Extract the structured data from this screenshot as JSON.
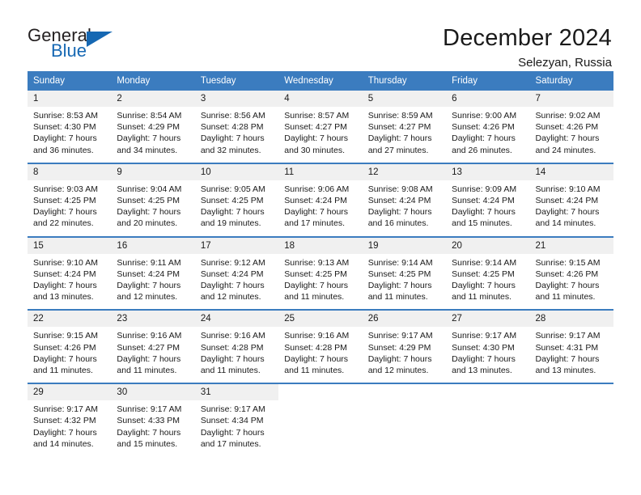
{
  "logo": {
    "word_top": "General",
    "word_bottom": "Blue",
    "triangle_color": "#1668b3"
  },
  "header": {
    "title": "December 2024",
    "subtitle": "Selezyan, Russia"
  },
  "theme": {
    "header_blue": "#3b7cbf",
    "daynum_bg": "#f0f0f0",
    "text": "#1a1a1a"
  },
  "calendar": {
    "weekday_headers": [
      "Sunday",
      "Monday",
      "Tuesday",
      "Wednesday",
      "Thursday",
      "Friday",
      "Saturday"
    ],
    "weeks": [
      [
        {
          "day": "1",
          "sunrise": "Sunrise: 8:53 AM",
          "sunset": "Sunset: 4:30 PM",
          "daylight_line1": "Daylight: 7 hours",
          "daylight_line2": "and 36 minutes."
        },
        {
          "day": "2",
          "sunrise": "Sunrise: 8:54 AM",
          "sunset": "Sunset: 4:29 PM",
          "daylight_line1": "Daylight: 7 hours",
          "daylight_line2": "and 34 minutes."
        },
        {
          "day": "3",
          "sunrise": "Sunrise: 8:56 AM",
          "sunset": "Sunset: 4:28 PM",
          "daylight_line1": "Daylight: 7 hours",
          "daylight_line2": "and 32 minutes."
        },
        {
          "day": "4",
          "sunrise": "Sunrise: 8:57 AM",
          "sunset": "Sunset: 4:27 PM",
          "daylight_line1": "Daylight: 7 hours",
          "daylight_line2": "and 30 minutes."
        },
        {
          "day": "5",
          "sunrise": "Sunrise: 8:59 AM",
          "sunset": "Sunset: 4:27 PM",
          "daylight_line1": "Daylight: 7 hours",
          "daylight_line2": "and 27 minutes."
        },
        {
          "day": "6",
          "sunrise": "Sunrise: 9:00 AM",
          "sunset": "Sunset: 4:26 PM",
          "daylight_line1": "Daylight: 7 hours",
          "daylight_line2": "and 26 minutes."
        },
        {
          "day": "7",
          "sunrise": "Sunrise: 9:02 AM",
          "sunset": "Sunset: 4:26 PM",
          "daylight_line1": "Daylight: 7 hours",
          "daylight_line2": "and 24 minutes."
        }
      ],
      [
        {
          "day": "8",
          "sunrise": "Sunrise: 9:03 AM",
          "sunset": "Sunset: 4:25 PM",
          "daylight_line1": "Daylight: 7 hours",
          "daylight_line2": "and 22 minutes."
        },
        {
          "day": "9",
          "sunrise": "Sunrise: 9:04 AM",
          "sunset": "Sunset: 4:25 PM",
          "daylight_line1": "Daylight: 7 hours",
          "daylight_line2": "and 20 minutes."
        },
        {
          "day": "10",
          "sunrise": "Sunrise: 9:05 AM",
          "sunset": "Sunset: 4:25 PM",
          "daylight_line1": "Daylight: 7 hours",
          "daylight_line2": "and 19 minutes."
        },
        {
          "day": "11",
          "sunrise": "Sunrise: 9:06 AM",
          "sunset": "Sunset: 4:24 PM",
          "daylight_line1": "Daylight: 7 hours",
          "daylight_line2": "and 17 minutes."
        },
        {
          "day": "12",
          "sunrise": "Sunrise: 9:08 AM",
          "sunset": "Sunset: 4:24 PM",
          "daylight_line1": "Daylight: 7 hours",
          "daylight_line2": "and 16 minutes."
        },
        {
          "day": "13",
          "sunrise": "Sunrise: 9:09 AM",
          "sunset": "Sunset: 4:24 PM",
          "daylight_line1": "Daylight: 7 hours",
          "daylight_line2": "and 15 minutes."
        },
        {
          "day": "14",
          "sunrise": "Sunrise: 9:10 AM",
          "sunset": "Sunset: 4:24 PM",
          "daylight_line1": "Daylight: 7 hours",
          "daylight_line2": "and 14 minutes."
        }
      ],
      [
        {
          "day": "15",
          "sunrise": "Sunrise: 9:10 AM",
          "sunset": "Sunset: 4:24 PM",
          "daylight_line1": "Daylight: 7 hours",
          "daylight_line2": "and 13 minutes."
        },
        {
          "day": "16",
          "sunrise": "Sunrise: 9:11 AM",
          "sunset": "Sunset: 4:24 PM",
          "daylight_line1": "Daylight: 7 hours",
          "daylight_line2": "and 12 minutes."
        },
        {
          "day": "17",
          "sunrise": "Sunrise: 9:12 AM",
          "sunset": "Sunset: 4:24 PM",
          "daylight_line1": "Daylight: 7 hours",
          "daylight_line2": "and 12 minutes."
        },
        {
          "day": "18",
          "sunrise": "Sunrise: 9:13 AM",
          "sunset": "Sunset: 4:25 PM",
          "daylight_line1": "Daylight: 7 hours",
          "daylight_line2": "and 11 minutes."
        },
        {
          "day": "19",
          "sunrise": "Sunrise: 9:14 AM",
          "sunset": "Sunset: 4:25 PM",
          "daylight_line1": "Daylight: 7 hours",
          "daylight_line2": "and 11 minutes."
        },
        {
          "day": "20",
          "sunrise": "Sunrise: 9:14 AM",
          "sunset": "Sunset: 4:25 PM",
          "daylight_line1": "Daylight: 7 hours",
          "daylight_line2": "and 11 minutes."
        },
        {
          "day": "21",
          "sunrise": "Sunrise: 9:15 AM",
          "sunset": "Sunset: 4:26 PM",
          "daylight_line1": "Daylight: 7 hours",
          "daylight_line2": "and 11 minutes."
        }
      ],
      [
        {
          "day": "22",
          "sunrise": "Sunrise: 9:15 AM",
          "sunset": "Sunset: 4:26 PM",
          "daylight_line1": "Daylight: 7 hours",
          "daylight_line2": "and 11 minutes."
        },
        {
          "day": "23",
          "sunrise": "Sunrise: 9:16 AM",
          "sunset": "Sunset: 4:27 PM",
          "daylight_line1": "Daylight: 7 hours",
          "daylight_line2": "and 11 minutes."
        },
        {
          "day": "24",
          "sunrise": "Sunrise: 9:16 AM",
          "sunset": "Sunset: 4:28 PM",
          "daylight_line1": "Daylight: 7 hours",
          "daylight_line2": "and 11 minutes."
        },
        {
          "day": "25",
          "sunrise": "Sunrise: 9:16 AM",
          "sunset": "Sunset: 4:28 PM",
          "daylight_line1": "Daylight: 7 hours",
          "daylight_line2": "and 11 minutes."
        },
        {
          "day": "26",
          "sunrise": "Sunrise: 9:17 AM",
          "sunset": "Sunset: 4:29 PM",
          "daylight_line1": "Daylight: 7 hours",
          "daylight_line2": "and 12 minutes."
        },
        {
          "day": "27",
          "sunrise": "Sunrise: 9:17 AM",
          "sunset": "Sunset: 4:30 PM",
          "daylight_line1": "Daylight: 7 hours",
          "daylight_line2": "and 13 minutes."
        },
        {
          "day": "28",
          "sunrise": "Sunrise: 9:17 AM",
          "sunset": "Sunset: 4:31 PM",
          "daylight_line1": "Daylight: 7 hours",
          "daylight_line2": "and 13 minutes."
        }
      ],
      [
        {
          "day": "29",
          "sunrise": "Sunrise: 9:17 AM",
          "sunset": "Sunset: 4:32 PM",
          "daylight_line1": "Daylight: 7 hours",
          "daylight_line2": "and 14 minutes."
        },
        {
          "day": "30",
          "sunrise": "Sunrise: 9:17 AM",
          "sunset": "Sunset: 4:33 PM",
          "daylight_line1": "Daylight: 7 hours",
          "daylight_line2": "and 15 minutes."
        },
        {
          "day": "31",
          "sunrise": "Sunrise: 9:17 AM",
          "sunset": "Sunset: 4:34 PM",
          "daylight_line1": "Daylight: 7 hours",
          "daylight_line2": "and 17 minutes."
        },
        {
          "day": "",
          "sunrise": "",
          "sunset": "",
          "daylight_line1": "",
          "daylight_line2": ""
        },
        {
          "day": "",
          "sunrise": "",
          "sunset": "",
          "daylight_line1": "",
          "daylight_line2": ""
        },
        {
          "day": "",
          "sunrise": "",
          "sunset": "",
          "daylight_line1": "",
          "daylight_line2": ""
        },
        {
          "day": "",
          "sunrise": "",
          "sunset": "",
          "daylight_line1": "",
          "daylight_line2": ""
        }
      ]
    ]
  }
}
